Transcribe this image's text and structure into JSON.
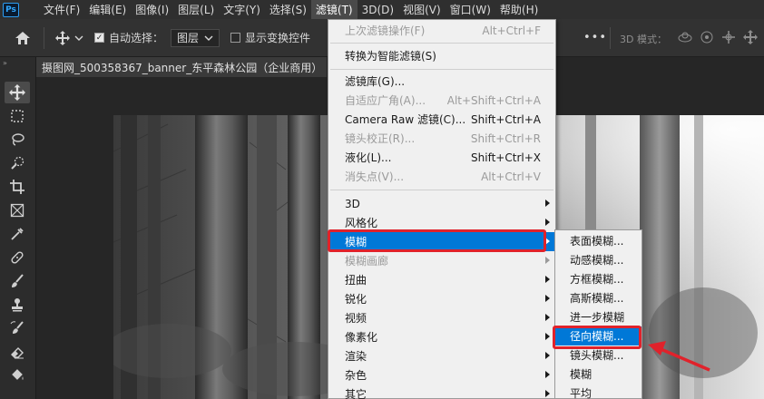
{
  "menubar": {
    "logo": "Ps",
    "items": [
      "文件(F)",
      "编辑(E)",
      "图像(I)",
      "图层(L)",
      "文字(Y)",
      "选择(S)",
      "滤镜(T)",
      "3D(D)",
      "视图(V)",
      "窗口(W)",
      "帮助(H)"
    ],
    "active_index": 6
  },
  "options_bar": {
    "auto_select_label": "自动选择：",
    "auto_select_checked": true,
    "auto_select_value": "图层",
    "show_transform_label": "显示变换控件",
    "show_transform_checked": false,
    "more_label": "•••",
    "mode_3d_label": "3D 模式："
  },
  "document_tab": {
    "title": "摄图网_500358367_banner_东平森林公园（企业商用）"
  },
  "filter_menu": {
    "items": [
      {
        "label": "上次滤镜操作(F)",
        "shortcut": "Alt+Ctrl+F",
        "disabled": true
      },
      {
        "label": "转换为智能滤镜(S)",
        "shortcut": "",
        "disabled": false
      },
      {
        "label": "滤镜库(G)...",
        "shortcut": "",
        "disabled": false
      },
      {
        "label": "自适应广角(A)...",
        "shortcut": "Alt+Shift+Ctrl+A",
        "disabled": true
      },
      {
        "label": "Camera Raw 滤镜(C)...",
        "shortcut": "Shift+Ctrl+A",
        "disabled": false
      },
      {
        "label": "镜头校正(R)...",
        "shortcut": "Shift+Ctrl+R",
        "disabled": true
      },
      {
        "label": "液化(L)...",
        "shortcut": "Shift+Ctrl+X",
        "disabled": false
      },
      {
        "label": "消失点(V)...",
        "shortcut": "Alt+Ctrl+V",
        "disabled": true
      },
      {
        "label": "3D",
        "submenu": true,
        "disabled": false
      },
      {
        "label": "风格化",
        "submenu": true,
        "disabled": false
      },
      {
        "label": "模糊",
        "submenu": true,
        "disabled": false,
        "highlighted": true
      },
      {
        "label": "模糊画廊",
        "submenu": true,
        "disabled": true
      },
      {
        "label": "扭曲",
        "submenu": true,
        "disabled": false
      },
      {
        "label": "锐化",
        "submenu": true,
        "disabled": false
      },
      {
        "label": "视频",
        "submenu": true,
        "disabled": false
      },
      {
        "label": "像素化",
        "submenu": true,
        "disabled": false
      },
      {
        "label": "渲染",
        "submenu": true,
        "disabled": false
      },
      {
        "label": "杂色",
        "submenu": true,
        "disabled": false
      },
      {
        "label": "其它",
        "submenu": true,
        "disabled": false
      }
    ]
  },
  "blur_submenu": {
    "items": [
      "表面模糊...",
      "动感模糊...",
      "方框模糊...",
      "高斯模糊...",
      "进一步模糊",
      "径向模糊...",
      "镜头模糊...",
      "模糊",
      "平均"
    ],
    "highlighted_index": 5
  },
  "colors": {
    "highlight": "#0078d7",
    "annotation_red": "#e0222b"
  }
}
